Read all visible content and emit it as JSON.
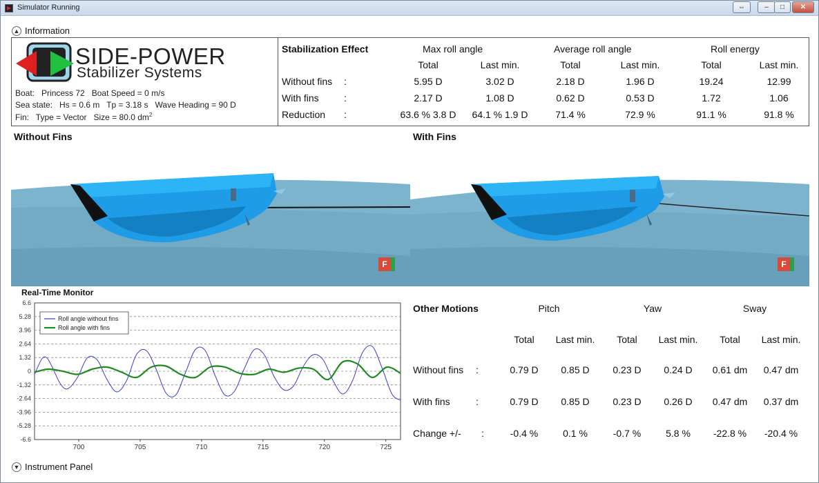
{
  "window": {
    "title": "Simulator Running"
  },
  "information": {
    "header": "Information",
    "brand_line1": "SIDE-POWER",
    "brand_line2": "Stabilizer Systems",
    "boat": "Boat:   Princess 72   Boat Speed = 0 m/s",
    "sea_state": "Sea state:   Hs = 0.6 m   Tp = 3.18 s   Wave Heading = 90 D",
    "fin": "Fin:   Type = Vector   Size = 80.0 dm",
    "fin_sup": "2"
  },
  "stabilization": {
    "title": "Stabilization Effect",
    "groups": [
      "Max roll angle",
      "Average roll angle",
      "Roll energy"
    ],
    "subcols": [
      "Total",
      "Last min.",
      "Total",
      "Last min.",
      "Total",
      "Last min."
    ],
    "rows": [
      {
        "label": "Without fins",
        "sep": ":",
        "values": [
          "5.95 D",
          "3.02 D",
          "2.18 D",
          "1.96 D",
          "19.24",
          "12.99"
        ]
      },
      {
        "label": "With fins",
        "sep": ":",
        "values": [
          "2.17 D",
          "1.08 D",
          "0.62 D",
          "0.53 D",
          "1.72",
          "1.06"
        ]
      },
      {
        "label": "Reduction",
        "sep": ":",
        "values": [
          "63.6 % 3.8 D",
          "64.1 % 1.9 D",
          "71.4 %",
          "72.9 %",
          "91.1 %",
          "91.8 %"
        ]
      }
    ]
  },
  "views": {
    "left_label": "Without Fins",
    "right_label": "With Fins",
    "cube_letter": "F",
    "water_color": "#7bb3cc",
    "hull_color": "#22a3ee"
  },
  "monitor": {
    "title": "Real-Time Monitor"
  },
  "chart_data": {
    "type": "line",
    "xlim": [
      696.4,
      726.2
    ],
    "ylim": [
      -6.6,
      6.6
    ],
    "xticks": [
      700,
      705,
      710,
      715,
      720,
      725
    ],
    "yticks": [
      "6.6",
      "5.28",
      "3.96",
      "2.64",
      "1.32",
      "0",
      "-1.32",
      "-2.64",
      "-3.96",
      "-5.28",
      "-6.6"
    ],
    "legend_position": "top-left",
    "grid": "horizontal dashed",
    "series": [
      {
        "name": "Roll angle without fins",
        "color": "#3b3bd1",
        "x": [
          696.4,
          697.0,
          697.4,
          697.8,
          698.5,
          699.1,
          699.9,
          700.7,
          701.5,
          702.3,
          703.1,
          703.9,
          704.7,
          705.5,
          706.3,
          707.1,
          707.9,
          708.7,
          709.5,
          710.3,
          711.1,
          711.9,
          712.7,
          713.5,
          714.3,
          715.1,
          715.9,
          716.7,
          717.5,
          718.3,
          719.1,
          719.9,
          720.7,
          721.5,
          722.3,
          723.1,
          723.9,
          724.7,
          725.5,
          726.2
        ],
        "y": [
          -0.3,
          1.2,
          1.3,
          0.5,
          -1.2,
          -1.7,
          -0.6,
          1.3,
          1.1,
          -0.8,
          -2.0,
          -0.9,
          1.6,
          2.0,
          0.2,
          -2.1,
          -2.3,
          -0.1,
          2.1,
          2.0,
          -0.4,
          -2.3,
          -1.9,
          0.3,
          2.1,
          1.6,
          -0.5,
          -1.8,
          -1.4,
          0.5,
          1.6,
          1.1,
          -0.9,
          -2.2,
          -0.9,
          1.8,
          2.4,
          0.3,
          -2.2,
          -2.8
        ]
      },
      {
        "name": "Roll angle with fins",
        "color": "#1f8a1f",
        "x": [
          696.4,
          697.5,
          698.7,
          699.9,
          701.1,
          702.3,
          703.5,
          704.7,
          705.9,
          707.1,
          708.3,
          709.5,
          710.7,
          711.9,
          713.1,
          714.3,
          715.5,
          716.7,
          717.9,
          719.1,
          720.3,
          721.5,
          722.7,
          723.9,
          725.1,
          726.2
        ],
        "y": [
          -0.1,
          0.2,
          0.0,
          -0.3,
          0.2,
          0.4,
          -0.1,
          -0.6,
          0.4,
          0.5,
          -0.3,
          -0.6,
          0.4,
          0.4,
          -0.2,
          -0.3,
          0.2,
          -0.1,
          0.3,
          0.2,
          -0.8,
          0.9,
          0.7,
          -0.6,
          0.4,
          -0.2
        ]
      }
    ]
  },
  "other_motions": {
    "title": "Other Motions",
    "groups": [
      "Pitch",
      "Yaw",
      "Sway"
    ],
    "subcols": [
      "Total",
      "Last min.",
      "Total",
      "Last min.",
      "Total",
      "Last min."
    ],
    "rows": [
      {
        "label": "Without fins",
        "sep": ":",
        "values": [
          "0.79 D",
          "0.85 D",
          "0.23 D",
          "0.24 D",
          "0.61 dm",
          "0.47 dm"
        ]
      },
      {
        "label": "With fins",
        "sep": ":",
        "values": [
          "0.79 D",
          "0.85 D",
          "0.23 D",
          "0.26 D",
          "0.47 dm",
          "0.37 dm"
        ]
      },
      {
        "label": "Change +/-",
        "sep": ":",
        "values": [
          "-0.4 %",
          "0.1 %",
          "-0.7 %",
          "5.8 %",
          "-22.8 %",
          "-20.4 %"
        ]
      }
    ]
  },
  "instrument_panel": {
    "header": "Instrument Panel"
  }
}
